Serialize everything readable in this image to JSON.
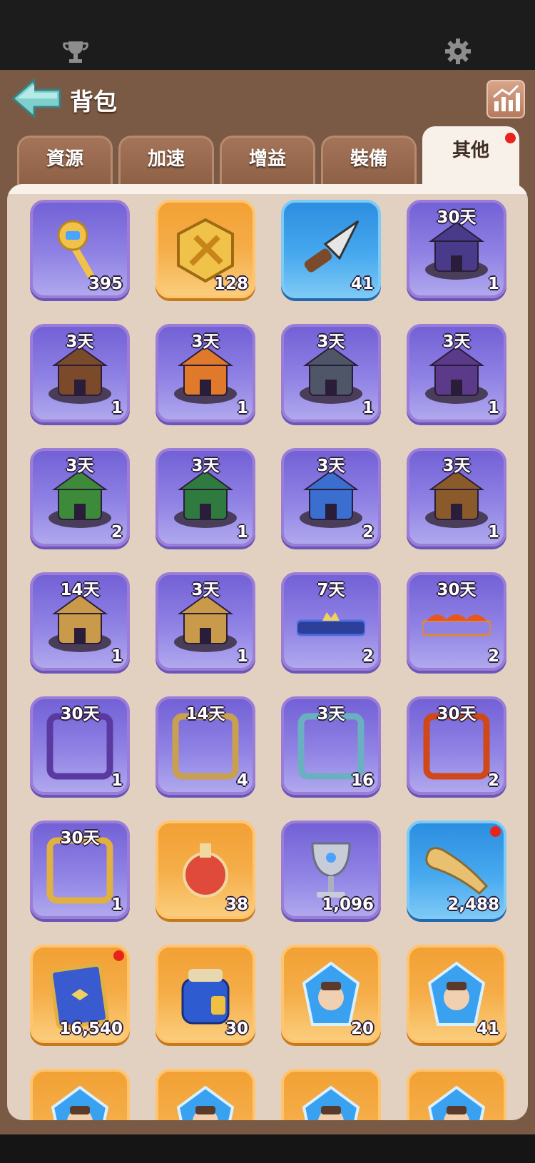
{
  "header": {
    "title": "背包",
    "trophy_icon": "trophy-icon",
    "settings_icon": "gear-icon",
    "back_icon": "back-arrow-icon",
    "stats_icon": "stats-chart-icon"
  },
  "tabs": [
    {
      "label": "資源",
      "active": false
    },
    {
      "label": "加速",
      "active": false
    },
    {
      "label": "增益",
      "active": false
    },
    {
      "label": "裝備",
      "active": false
    },
    {
      "label": "其他",
      "active": true,
      "badge": true
    }
  ],
  "items": [
    {
      "icon": "key-icon",
      "bg": "purple",
      "count": "395",
      "duration": ""
    },
    {
      "icon": "sword-medal-icon",
      "bg": "orange",
      "count": "128",
      "duration": ""
    },
    {
      "icon": "arrowhead-icon",
      "bg": "blue",
      "count": "41",
      "duration": ""
    },
    {
      "icon": "octopus-castle-skin-icon",
      "bg": "purple",
      "count": "1",
      "duration": "30天"
    },
    {
      "icon": "bear-castle-skin-icon",
      "bg": "purple",
      "count": "1",
      "duration": "3天"
    },
    {
      "icon": "autumn-castle-skin-icon",
      "bg": "purple",
      "count": "1",
      "duration": "3天"
    },
    {
      "icon": "tower-castle-skin-icon",
      "bg": "purple",
      "count": "1",
      "duration": "3天"
    },
    {
      "icon": "dark-castle-skin-icon",
      "bg": "purple",
      "count": "1",
      "duration": "3天"
    },
    {
      "icon": "christmas-castle-skin-icon",
      "bg": "purple",
      "count": "2",
      "duration": "3天"
    },
    {
      "icon": "pagoda-castle-skin-icon",
      "bg": "purple",
      "count": "1",
      "duration": "3天"
    },
    {
      "icon": "robot-castle-skin-icon",
      "bg": "purple",
      "count": "2",
      "duration": "3天"
    },
    {
      "icon": "stadium-castle-skin-icon",
      "bg": "purple",
      "count": "1",
      "duration": "3天"
    },
    {
      "icon": "island-castle-skin-icon",
      "bg": "purple",
      "count": "1",
      "duration": "14天"
    },
    {
      "icon": "island-castle-skin-icon",
      "bg": "purple",
      "count": "1",
      "duration": "3天"
    },
    {
      "icon": "crown-nameplate-icon",
      "bg": "purple",
      "count": "2",
      "duration": "7天"
    },
    {
      "icon": "lava-nameplate-icon",
      "bg": "purple",
      "count": "2",
      "duration": "30天"
    },
    {
      "icon": "octopus-avatar-frame-icon",
      "bg": "purple",
      "count": "1",
      "duration": "30天"
    },
    {
      "icon": "gold-avatar-frame-icon",
      "bg": "purple",
      "count": "4",
      "duration": "14天"
    },
    {
      "icon": "jade-avatar-frame-icon",
      "bg": "purple",
      "count": "16",
      "duration": "3天"
    },
    {
      "icon": "lava-avatar-frame-icon",
      "bg": "purple",
      "count": "2",
      "duration": "30天"
    },
    {
      "icon": "royal-avatar-frame-icon",
      "bg": "purple",
      "count": "1",
      "duration": "30天"
    },
    {
      "icon": "potion-flask-icon",
      "bg": "orange",
      "count": "38",
      "duration": ""
    },
    {
      "icon": "silver-chalice-icon",
      "bg": "purple",
      "count": "1,096",
      "duration": ""
    },
    {
      "icon": "horn-icon",
      "bg": "blue",
      "count": "2,488",
      "duration": "",
      "badge": true
    },
    {
      "icon": "tome-icon",
      "bg": "orange",
      "count": "16,540",
      "duration": "",
      "badge": true
    },
    {
      "icon": "backpack-icon",
      "bg": "orange",
      "count": "30",
      "duration": ""
    },
    {
      "icon": "commander-hat-crystal-icon",
      "bg": "orange",
      "count": "20",
      "duration": ""
    },
    {
      "icon": "hero-crystal-icon",
      "bg": "orange",
      "count": "41",
      "duration": ""
    },
    {
      "icon": "wizard-crystal-icon",
      "bg": "orange",
      "count": "",
      "duration": ""
    },
    {
      "icon": "warrior-crystal-icon",
      "bg": "orange",
      "count": "",
      "duration": ""
    },
    {
      "icon": "maiden-crystal-icon",
      "bg": "orange",
      "count": "",
      "duration": ""
    },
    {
      "icon": "queen-crystal-icon",
      "bg": "orange",
      "count": "",
      "duration": ""
    }
  ],
  "colors": {
    "brown_bg": "#7a5a45",
    "panel_bg": "#e2d1c1",
    "purple_cell": "#8f82e4",
    "orange_cell": "#f5ad48",
    "blue_cell": "#46a8ee",
    "badge_red": "#e8231c"
  }
}
